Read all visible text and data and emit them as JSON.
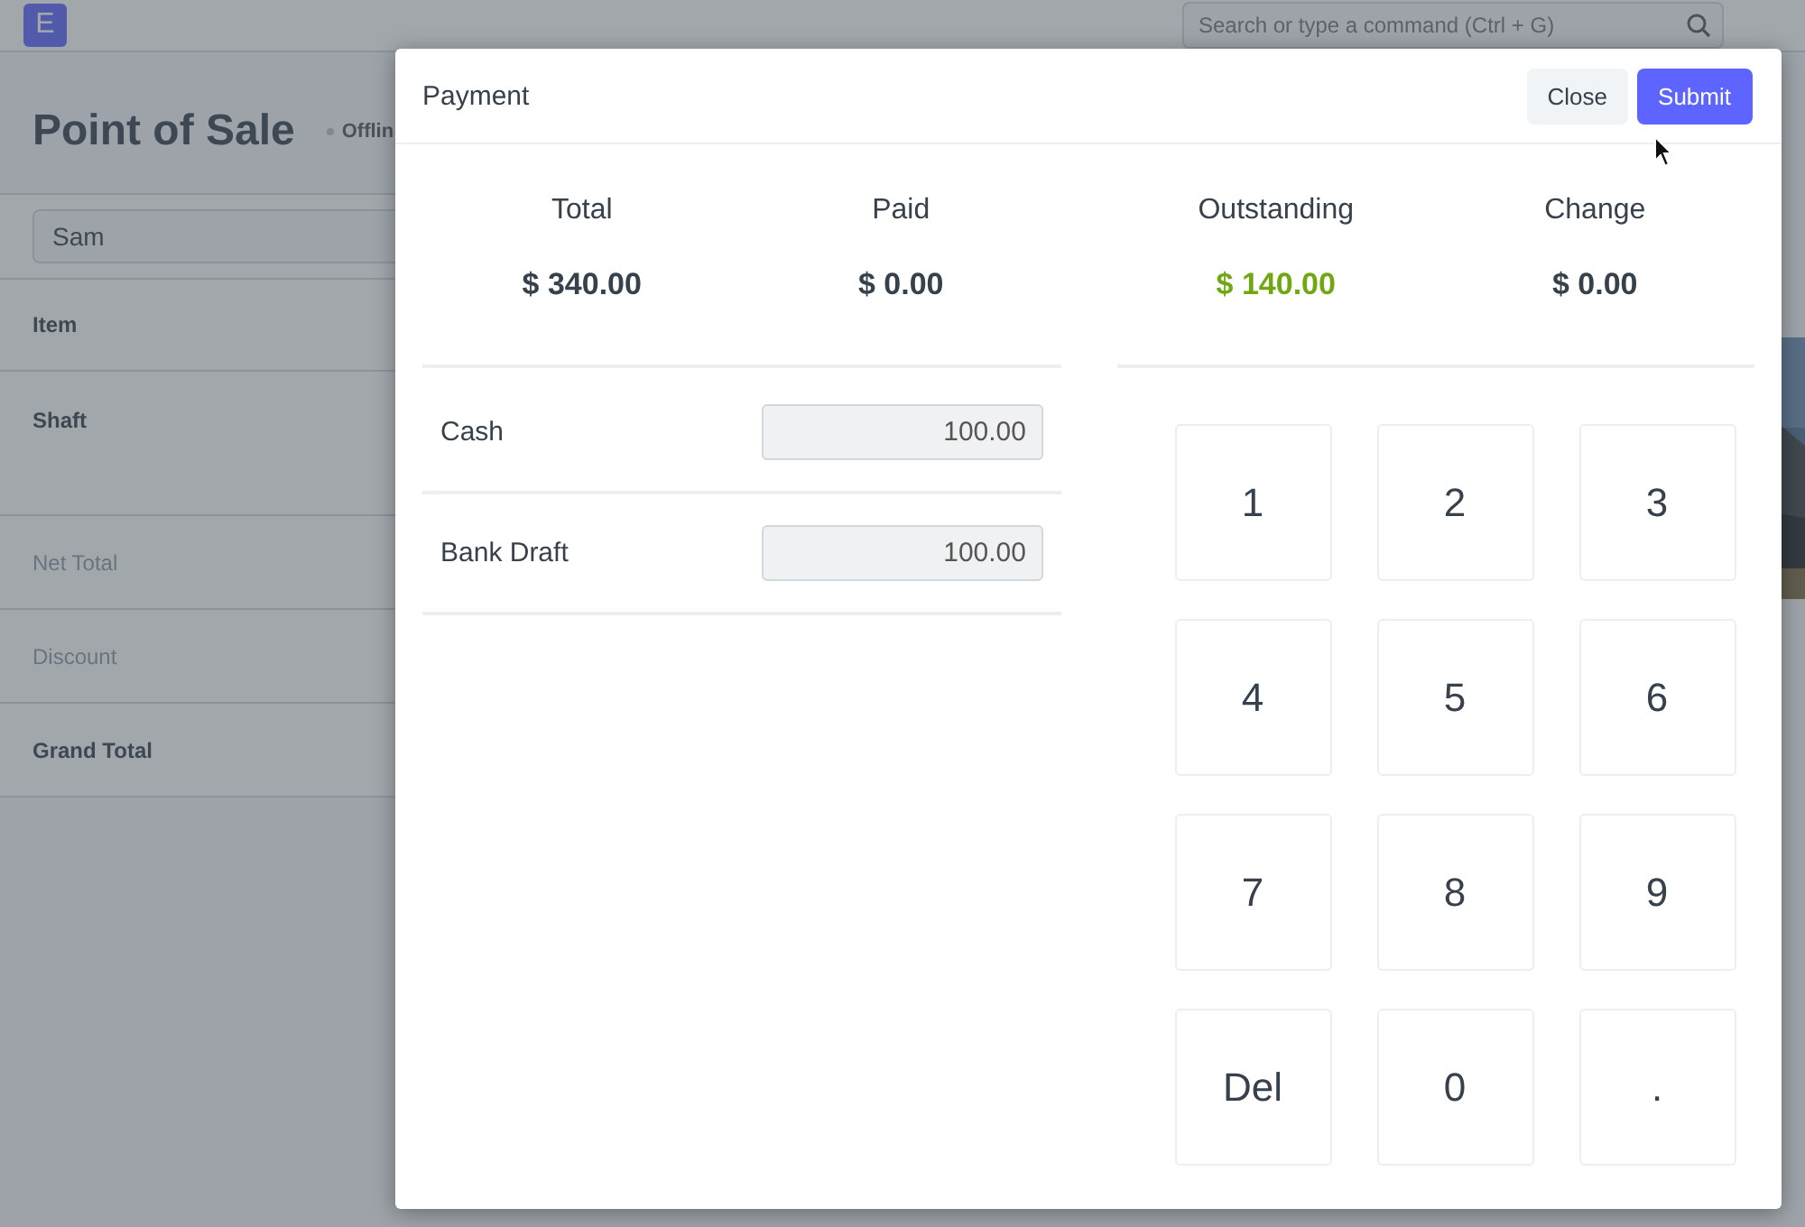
{
  "app": {
    "logo": "E",
    "search": {
      "placeholder": "Search or type a command (Ctrl + G)"
    }
  },
  "page": {
    "title": "Point of Sale",
    "status": "Offlin"
  },
  "customer": {
    "value": "Sam"
  },
  "cart": {
    "columns": [
      "Item"
    ],
    "rows": [
      "Shaft"
    ],
    "totals": [
      {
        "label": "Net Total",
        "kind": "muted"
      },
      {
        "label": "Discount",
        "kind": "muted"
      },
      {
        "label": "Grand Total",
        "kind": "strong"
      }
    ]
  },
  "dialog": {
    "title": "Payment",
    "buttons": [
      {
        "label": "Close",
        "kind": "secondary"
      },
      {
        "label": "Submit",
        "kind": "primary"
      }
    ],
    "summary": [
      {
        "label": "Total",
        "amount": "$ 340.00",
        "color": "#36414c"
      },
      {
        "label": "Paid",
        "amount": "$ 0.00",
        "color": "#36414c"
      },
      {
        "label": "Outstanding",
        "amount": "$ 140.00",
        "color": "#6fa813"
      },
      {
        "label": "Change",
        "amount": "$ 0.00",
        "color": "#36414c"
      }
    ],
    "payments": [
      {
        "mode": "Cash",
        "amount": "100.00"
      },
      {
        "mode": "Bank Draft",
        "amount": "100.00"
      }
    ],
    "keypad": [
      "1",
      "2",
      "3",
      "4",
      "5",
      "6",
      "7",
      "8",
      "9",
      "Del",
      "0",
      "."
    ]
  }
}
